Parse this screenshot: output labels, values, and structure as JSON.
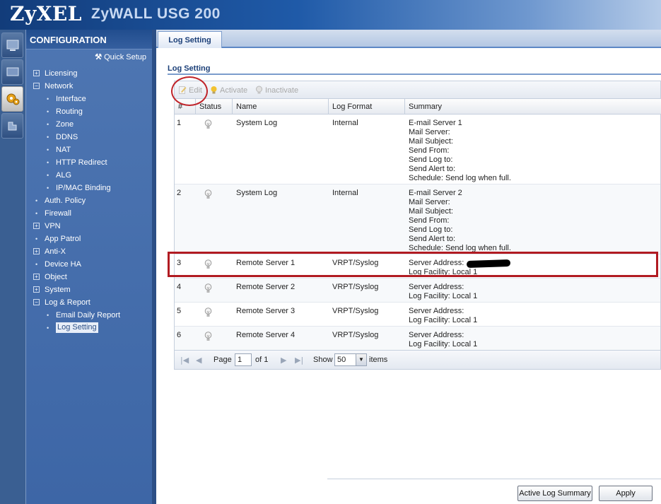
{
  "header": {
    "logo": "ZyXEL",
    "product": "ZyWALL USG 200"
  },
  "iconbar": {
    "icons": [
      "dashboard-icon",
      "monitor-icon",
      "configuration-icon",
      "maintenance-icon"
    ]
  },
  "nav": {
    "title": "CONFIGURATION",
    "quick_setup": "Quick Setup",
    "items": [
      {
        "label": "Licensing",
        "kind": "expand",
        "mark": "+"
      },
      {
        "label": "Network",
        "kind": "expand",
        "mark": "−"
      },
      {
        "label": "Interface",
        "kind": "child"
      },
      {
        "label": "Routing",
        "kind": "child"
      },
      {
        "label": "Zone",
        "kind": "child"
      },
      {
        "label": "DDNS",
        "kind": "child"
      },
      {
        "label": "NAT",
        "kind": "child"
      },
      {
        "label": "HTTP Redirect",
        "kind": "child"
      },
      {
        "label": "ALG",
        "kind": "child"
      },
      {
        "label": "IP/MAC Binding",
        "kind": "child"
      },
      {
        "label": "Auth. Policy",
        "kind": "leaf"
      },
      {
        "label": "Firewall",
        "kind": "leaf"
      },
      {
        "label": "VPN",
        "kind": "expand",
        "mark": "+"
      },
      {
        "label": "App Patrol",
        "kind": "leaf"
      },
      {
        "label": "Anti-X",
        "kind": "expand",
        "mark": "+"
      },
      {
        "label": "Device HA",
        "kind": "leaf"
      },
      {
        "label": "Object",
        "kind": "expand",
        "mark": "+"
      },
      {
        "label": "System",
        "kind": "expand",
        "mark": "+"
      },
      {
        "label": "Log & Report",
        "kind": "expand",
        "mark": "−"
      },
      {
        "label": "Email Daily Report",
        "kind": "child"
      },
      {
        "label": "Log Setting",
        "kind": "child",
        "selected": true
      }
    ]
  },
  "tab": {
    "label": "Log Setting"
  },
  "section": {
    "title": "Log Setting"
  },
  "toolbar": {
    "edit": "Edit",
    "activate": "Activate",
    "inactivate": "Inactivate"
  },
  "table": {
    "columns": [
      "#",
      "Status",
      "Name",
      "Log Format",
      "Summary"
    ],
    "rows": [
      {
        "num": "1",
        "name": "System Log",
        "format": "Internal",
        "summary": [
          "E-mail Server 1",
          "Mail Server:",
          "Mail Subject:",
          "Send From:",
          "Send Log to:",
          "Send Alert to:",
          "Schedule: Send log when full."
        ]
      },
      {
        "num": "2",
        "name": "System Log",
        "format": "Internal",
        "summary": [
          "E-mail Server 2",
          "Mail Server:",
          "Mail Subject:",
          "Send From:",
          "Send Log to:",
          "Send Alert to:",
          "Schedule: Send log when full."
        ]
      },
      {
        "num": "3",
        "name": "Remote Server 1",
        "format": "VRPT/Syslog",
        "summary": [
          "Server Address:",
          "Log Facility: Local 1"
        ]
      },
      {
        "num": "4",
        "name": "Remote Server 2",
        "format": "VRPT/Syslog",
        "summary": [
          "Server Address:",
          "Log Facility: Local 1"
        ]
      },
      {
        "num": "5",
        "name": "Remote Server 3",
        "format": "VRPT/Syslog",
        "summary": [
          "Server Address:",
          "Log Facility: Local 1"
        ]
      },
      {
        "num": "6",
        "name": "Remote Server 4",
        "format": "VRPT/Syslog",
        "summary": [
          "Server Address:",
          "Log Facility: Local 1"
        ]
      }
    ]
  },
  "pager": {
    "page_label": "Page",
    "page_value": "1",
    "of_label": "of 1",
    "show_label": "Show",
    "show_value": "50",
    "items_label": "items"
  },
  "buttons": {
    "active_log_summary": "Active Log Summary",
    "apply": "Apply"
  },
  "colors": {
    "header": "#1f5aa8",
    "nav": "#4e76b2",
    "annotation": "#c0242a"
  }
}
